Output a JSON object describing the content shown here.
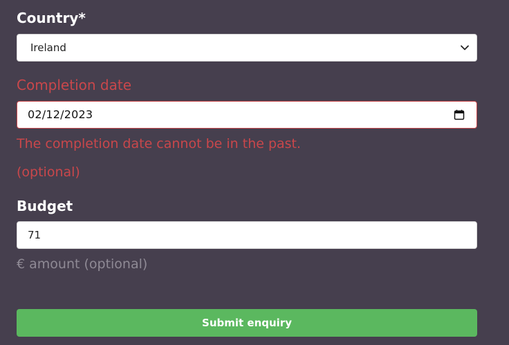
{
  "country": {
    "label": "Country*",
    "selected": "Ireland"
  },
  "completion_date": {
    "label": "Completion date",
    "value": "02/12/2023",
    "error": "The completion date cannot be in the past.",
    "hint": "(optional)"
  },
  "budget": {
    "label": "Budget",
    "value": "71",
    "hint": "€ amount (optional)"
  },
  "submit": {
    "label": "Submit enquiry"
  },
  "colors": {
    "background": "#463f4e",
    "error": "#c9474b",
    "submit": "#5bb85f",
    "hint": "#8f8a95"
  },
  "icons": {
    "select": "chevron-down-icon",
    "date": "calendar-icon"
  }
}
